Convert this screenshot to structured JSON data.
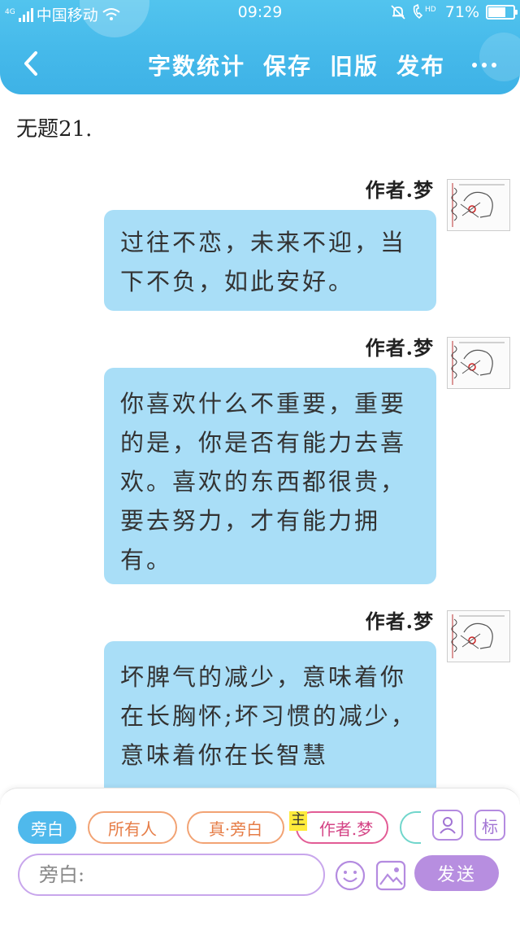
{
  "status_bar": {
    "network_type": "4G",
    "carrier": "中国移动",
    "time": "09:29",
    "hd": "HD",
    "battery": "71%",
    "battery_level": 0.71
  },
  "nav": {
    "back_icon": "chevron-left-icon",
    "actions": [
      "字数统计",
      "保存",
      "旧版",
      "发布"
    ],
    "more_icon": "more-dots-icon"
  },
  "document": {
    "title": "无题21."
  },
  "messages": [
    {
      "author": "作者.梦",
      "text": "过往不恋，未来不迎，当下不负，如此安好。"
    },
    {
      "author": "作者.梦",
      "text": "你喜欢什么不重要，重要的是，你是否有能力去喜欢。喜欢的东西都很贵，要去努力，才有能力拥有。"
    },
    {
      "author": "作者.梦",
      "text": "坏脾气的减少，意味着你在长胸怀;坏习惯的减少，意味着你在长智慧"
    }
  ],
  "composer": {
    "roles": [
      "旁白",
      "所有人",
      "真·旁白",
      "作者.梦"
    ],
    "main_tag": "主",
    "role_icon": "person-card-icon",
    "tag_label": "标",
    "placeholder": "旁白:",
    "emoji_icon": "smiley-icon",
    "image_icon": "image-icon",
    "send_label": "发送"
  },
  "colors": {
    "header": "#45b9ea",
    "bubble": "#a9def7",
    "active_role": "#4fb9ec",
    "send": "#b78ee0"
  }
}
